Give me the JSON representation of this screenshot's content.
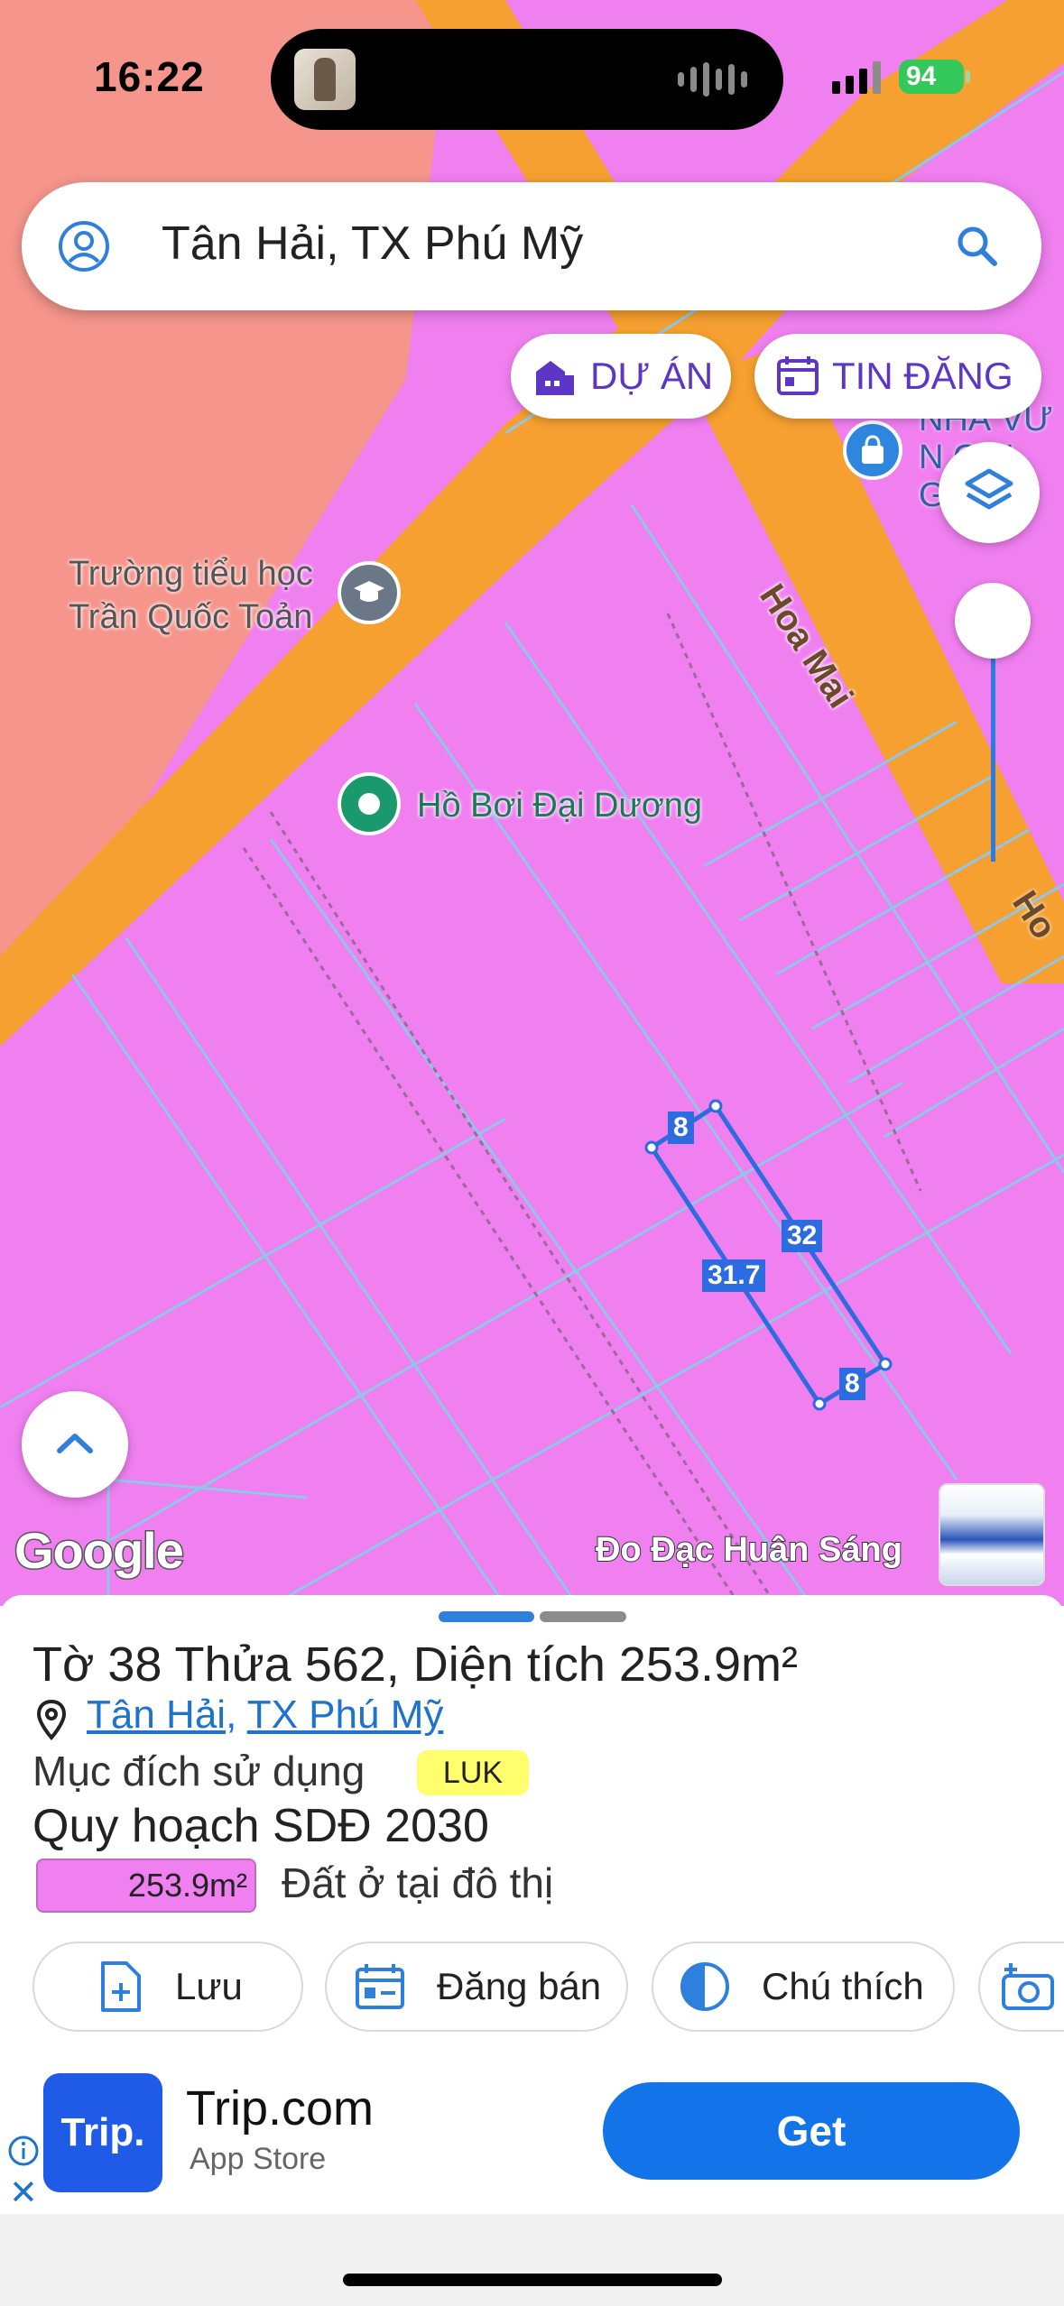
{
  "status_bar": {
    "time": "16:22",
    "battery": "94"
  },
  "search": {
    "query": "Tân Hải, TX Phú Mỹ"
  },
  "chips": {
    "project": "DỰ ÁN",
    "listings": "TIN ĐĂNG"
  },
  "map": {
    "pois": {
      "school_line1": "Trường tiểu học",
      "school_line2": "Trần Quốc Toản",
      "pool": "Hồ Bơi Đại Dương",
      "top_right_line1": "NHÀ VƯ",
      "top_right_line2": "N   O H",
      "top_right_line3": "G    en"
    },
    "street": "Hoa Mai",
    "street_fragment": "Ho",
    "parcel_dims": {
      "top": "8",
      "right": "32",
      "left": "31.7",
      "bottom": "8"
    },
    "google_logo": "Google",
    "watermark": "Đo Đạc Huân Sáng"
  },
  "parcel": {
    "title": "Tờ 38 Thửa 562, Diện tích 253.9m²",
    "ward": "Tân Hải",
    "separator": ", ",
    "town": "TX Phú Mỹ",
    "purpose_label": "Mục đích sử dụng",
    "purpose_code": "LUK",
    "planning_title": "Quy hoạch SDĐ 2030",
    "area_value": "253.9m²",
    "area_label": "Đất ở tại đô thị"
  },
  "actions": {
    "save": "Lưu",
    "sell": "Đăng bán",
    "legend": "Chú thích"
  },
  "ad": {
    "logo_text": "Trip.",
    "title": "Trip.com",
    "source": "App Store",
    "cta": "Get"
  },
  "colors": {
    "residential_land": "#f07ff0",
    "road": "#f5a030",
    "commercial_land": "#f5958c",
    "accent": "#1e73cc",
    "chip_text": "#5d36c6"
  }
}
